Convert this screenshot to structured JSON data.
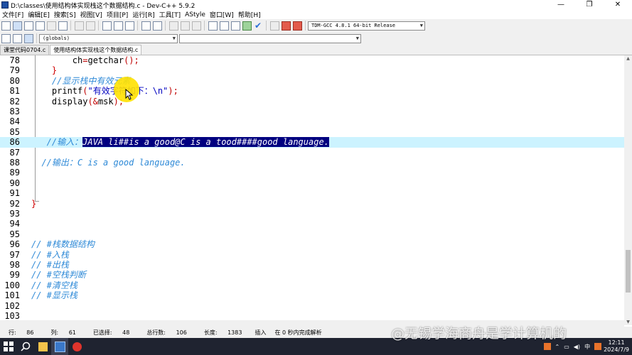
{
  "window": {
    "title": "D:\\classes\\使用结构体实现栈这个数据结构.c - Dev-C++ 5.9.2",
    "minimize": "—",
    "maximize": "❐",
    "close": "✕"
  },
  "menu": [
    "文件[F]",
    "编辑[E]",
    "搜索[S]",
    "视图[V]",
    "项目[P]",
    "运行[R]",
    "工具[T]",
    "AStyle",
    "窗口[W]",
    "帮助[H]"
  ],
  "toolbar": {
    "compiler_select": "TDM-GCC 4.8.1 64-bit Release",
    "scope_select": "(globals)",
    "member_select": ""
  },
  "tabs": [
    "课堂代码0704.c",
    "使用结构体实现栈这个数据结构.c"
  ],
  "editor": {
    "current_line": "86",
    "lines": [
      {
        "n": "78",
        "segs": [
          {
            "t": "        ch",
            "c": "kw"
          },
          {
            "t": "=",
            "c": "punc"
          },
          {
            "t": "getchar",
            "c": "kw"
          },
          {
            "t": "();",
            "c": "punc"
          }
        ]
      },
      {
        "n": "79",
        "segs": [
          {
            "t": "    ",
            "c": "kw"
          },
          {
            "t": "}",
            "c": "brace"
          }
        ]
      },
      {
        "n": "80",
        "segs": [
          {
            "t": "    //显示栈中有效元素",
            "c": "cmt"
          }
        ]
      },
      {
        "n": "81",
        "segs": [
          {
            "t": "    printf",
            "c": "kw"
          },
          {
            "t": "(",
            "c": "punc"
          },
          {
            "t": "\"有效字符如下：\\n\"",
            "c": "str"
          },
          {
            "t": ");",
            "c": "punc"
          }
        ]
      },
      {
        "n": "82",
        "segs": [
          {
            "t": "    display",
            "c": "kw"
          },
          {
            "t": "(&",
            "c": "punc"
          },
          {
            "t": "msk",
            "c": "kw"
          },
          {
            "t": ");",
            "c": "punc"
          }
        ]
      },
      {
        "n": "83",
        "segs": []
      },
      {
        "n": "84",
        "segs": []
      },
      {
        "n": "85",
        "segs": []
      },
      {
        "n": "86",
        "segs": [
          {
            "t": "   //输入：",
            "c": "cmt"
          },
          {
            "t": "JAVA li##is a good@C is a tood####good language.",
            "c": "sel"
          }
        ]
      },
      {
        "n": "87",
        "segs": []
      },
      {
        "n": "88",
        "segs": [
          {
            "t": "  //输出：C is a good language.",
            "c": "cmt"
          }
        ]
      },
      {
        "n": "89",
        "segs": []
      },
      {
        "n": "90",
        "segs": []
      },
      {
        "n": "91",
        "segs": []
      },
      {
        "n": "92",
        "segs": [
          {
            "t": "}",
            "c": "brace"
          }
        ]
      },
      {
        "n": "93",
        "segs": []
      },
      {
        "n": "94",
        "segs": []
      },
      {
        "n": "95",
        "segs": []
      },
      {
        "n": "96",
        "segs": [
          {
            "t": "// #栈数据结构",
            "c": "cmt"
          }
        ]
      },
      {
        "n": "97",
        "segs": [
          {
            "t": "// #入栈",
            "c": "cmt"
          }
        ]
      },
      {
        "n": "98",
        "segs": [
          {
            "t": "// #出栈",
            "c": "cmt"
          }
        ]
      },
      {
        "n": "99",
        "segs": [
          {
            "t": "// #空栈判断",
            "c": "cmt"
          }
        ]
      },
      {
        "n": "100",
        "segs": [
          {
            "t": "// #清空栈",
            "c": "cmt"
          }
        ]
      },
      {
        "n": "101",
        "segs": [
          {
            "t": "// #显示栈",
            "c": "cmt"
          }
        ]
      },
      {
        "n": "102",
        "segs": []
      },
      {
        "n": "103",
        "segs": []
      }
    ]
  },
  "status": {
    "row_label": "行:",
    "row": "86",
    "col_label": "列:",
    "col": "61",
    "sel_label": "已选择:",
    "sel": "48",
    "lines_label": "总行数:",
    "lines": "106",
    "len_label": "长度:",
    "len": "1383",
    "mode": "插入",
    "parse": "在 0 秒内完成解析"
  },
  "taskbar": {
    "tray_lang": "中",
    "time": "12:11",
    "date": "2024/7/9"
  },
  "watermark": "@无锡学海商舟是学计算机的"
}
